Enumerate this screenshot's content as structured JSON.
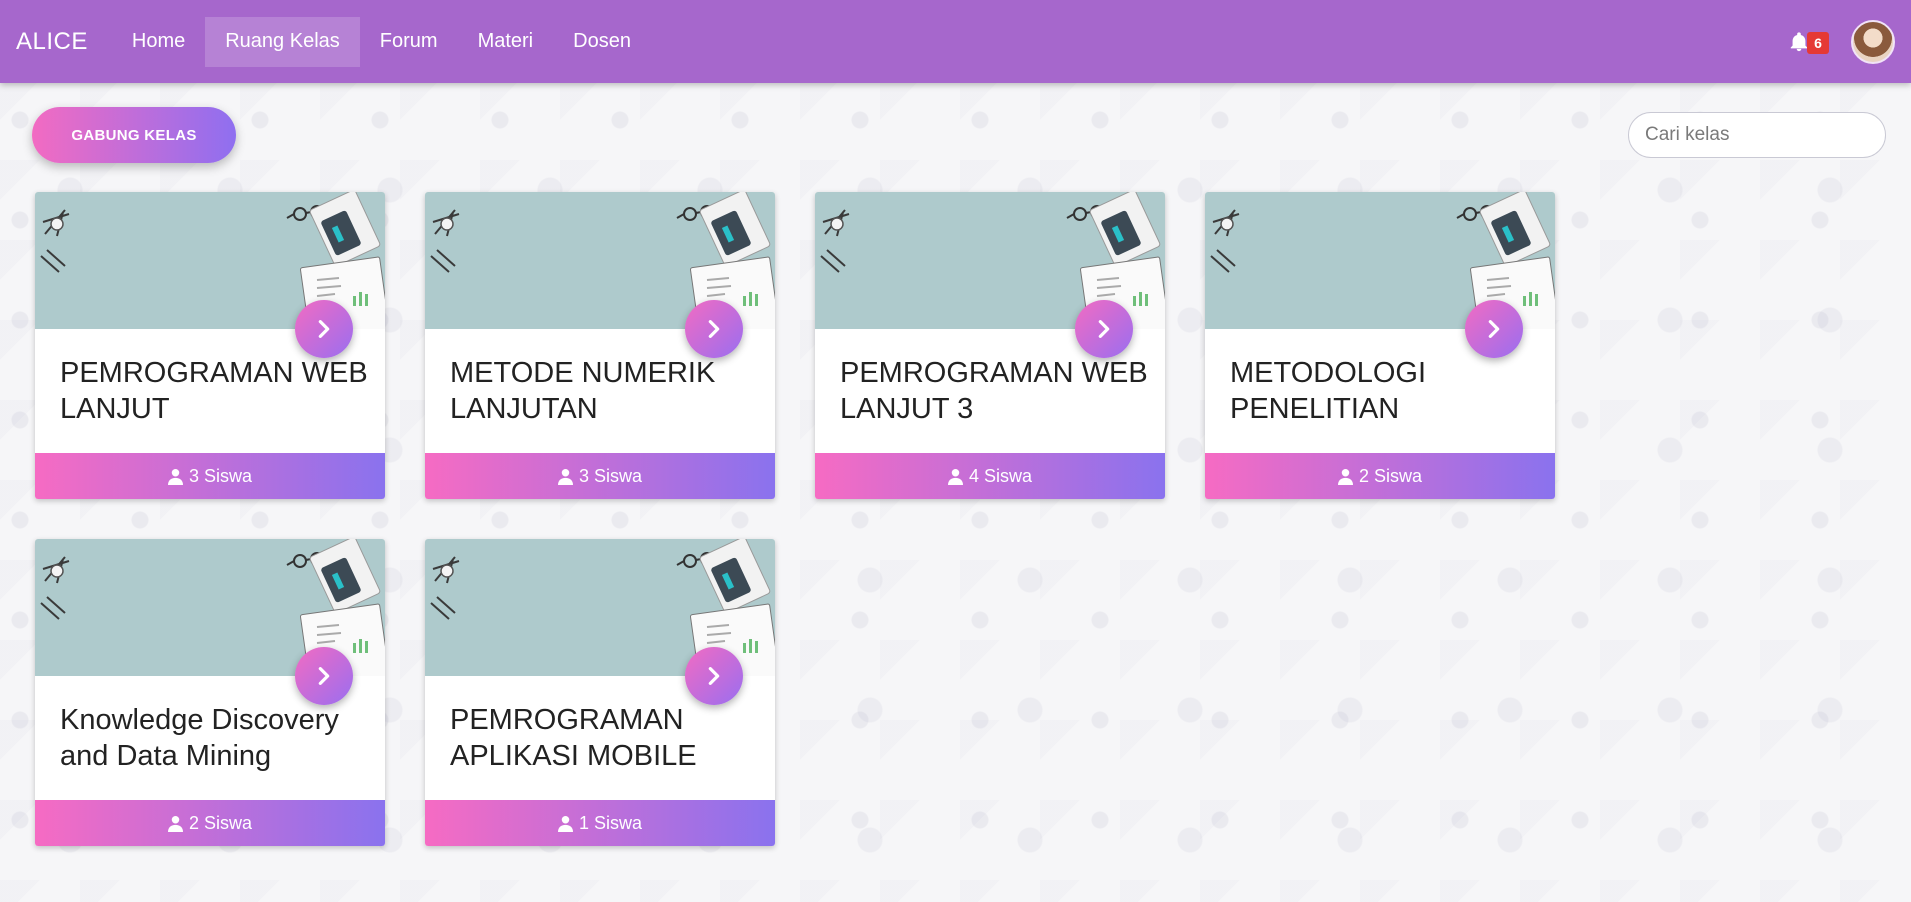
{
  "nav": {
    "brand": "ALICE",
    "links": [
      "Home",
      "Ruang Kelas",
      "Forum",
      "Materi",
      "Dosen"
    ],
    "active_link": "Ruang Kelas",
    "notification_count": "6"
  },
  "toolbar": {
    "join_label": "GABUNG KELAS",
    "search_placeholder": "Cari kelas"
  },
  "classes": [
    {
      "title": "PEMROGRAMAN WEB LANJUT",
      "students": "3 Siswa"
    },
    {
      "title": "METODE NUMERIK LANJUTAN",
      "students": "3 Siswa"
    },
    {
      "title": "PEMROGRAMAN WEB LANJUT 3",
      "students": "4 Siswa"
    },
    {
      "title": "METODOLOGI PENELITIAN",
      "students": "2 Siswa"
    },
    {
      "title": "Knowledge Discovery and Data Mining",
      "students": "2 Siswa"
    },
    {
      "title": "PEMROGRAMAN APLIKASI MOBILE",
      "students": "1 Siswa"
    }
  ],
  "colors": {
    "navbar": "#a667cc",
    "accent_start": "#f26bc2",
    "accent_end": "#8f6ff0",
    "card_image_bg": "#aecacc"
  },
  "icons": {
    "bell": "bell-icon",
    "go": "chevron-right-icon",
    "student": "user-icon"
  }
}
